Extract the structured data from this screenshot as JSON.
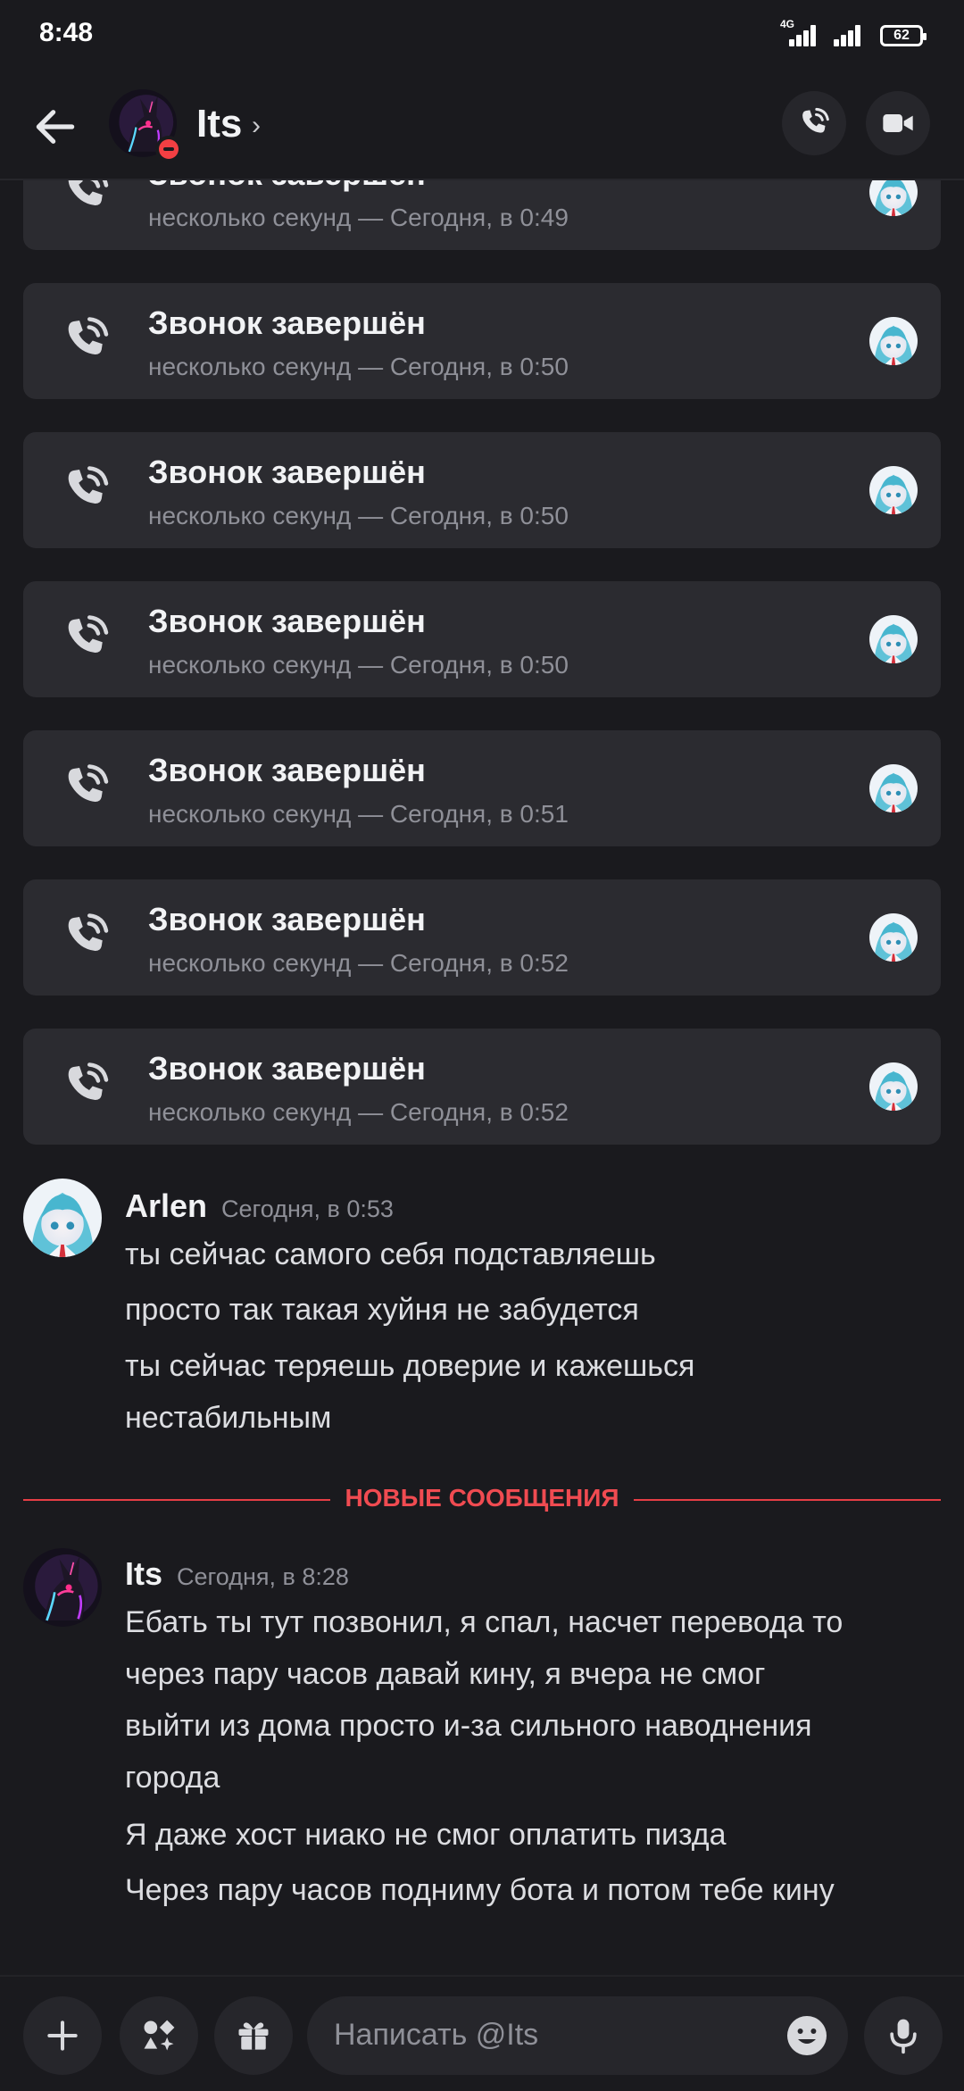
{
  "status_bar": {
    "time": "8:48",
    "network": "4G",
    "battery": "62"
  },
  "header": {
    "channel_name": "Its",
    "chevron": "›",
    "status": "do-not-disturb"
  },
  "calls": [
    {
      "title": "Звонок завершён",
      "subtitle": "несколько секунд — Сегодня, в 0:49"
    },
    {
      "title": "Звонок завершён",
      "subtitle": "несколько секунд — Сегодня, в 0:50"
    },
    {
      "title": "Звонок завершён",
      "subtitle": "несколько секунд — Сегодня, в 0:50"
    },
    {
      "title": "Звонок завершён",
      "subtitle": "несколько секунд — Сегодня, в 0:50"
    },
    {
      "title": "Звонок завершён",
      "subtitle": "несколько секунд — Сегодня, в 0:51"
    },
    {
      "title": "Звонок завершён",
      "subtitle": "несколько секунд — Сегодня, в 0:52"
    },
    {
      "title": "Звонок завершён",
      "subtitle": "несколько секунд — Сегодня, в 0:52"
    }
  ],
  "messages": [
    {
      "author": "Arlen",
      "time": "Сегодня, в 0:53",
      "lines": [
        "ты сейчас самого себя подставляешь",
        "просто так такая хуйня не забудется",
        "ты сейчас теряешь доверие и кажешься",
        "нестабильным"
      ]
    },
    {
      "author": "Its",
      "time": "Сегодня, в 8:28",
      "lines": [
        "Ебать ты тут позвонил, я спал, насчет перевода то",
        "через пару часов давай кину, я вчера не смог",
        "выйти из дома просто и-за сильного наводнения",
        "города",
        "Я даже хост ниако не смог оплатить пизда",
        "Через пару часов подниму бота и потом тебе кину"
      ]
    }
  ],
  "new_messages_divider": "НОВЫЕ СООБЩЕНИЯ",
  "composer": {
    "placeholder": "Написать @Its"
  },
  "colors": {
    "background": "#1a1a1e",
    "card": "#2b2b30",
    "accent_red": "#f04b51",
    "muted": "#8f9098"
  },
  "icons": [
    "back-arrow-icon",
    "phone-call-icon",
    "video-camera-icon",
    "plus-icon",
    "apps-icon",
    "gift-icon",
    "emoji-icon",
    "microphone-icon"
  ]
}
